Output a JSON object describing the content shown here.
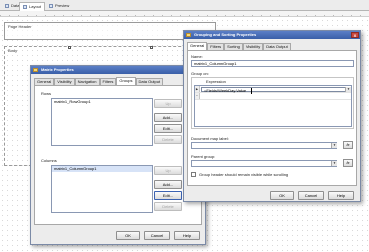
{
  "designer": {
    "tabs": [
      {
        "label": "Data"
      },
      {
        "label": "Layout"
      },
      {
        "label": "Preview"
      }
    ],
    "page_header_label": "Page Header",
    "body_label": "Body"
  },
  "matrix_dialog": {
    "title": "Matrix Properties",
    "tabs": [
      "General",
      "Visibility",
      "Navigation",
      "Filters",
      "Groups",
      "Data Output"
    ],
    "active_tab": "Groups",
    "rows_label": "Rows",
    "rows_items": [
      "matrix1_RowGroup1"
    ],
    "rows_buttons": [
      "Up",
      "Add...",
      "Edit...",
      "Delete"
    ],
    "columns_label": "Columns",
    "columns_items": [
      "matrix1_ColumnGroup1"
    ],
    "columns_buttons": [
      "Up",
      "Add...",
      "Edit...",
      "Delete"
    ],
    "footer_buttons": {
      "ok": "OK",
      "cancel": "Cancel",
      "help": "Help"
    }
  },
  "grouping_dialog": {
    "title": "Grouping and Sorting Properties",
    "close_glyph": "X",
    "tabs": [
      "General",
      "Filters",
      "Sorting",
      "Visibility",
      "Data Output"
    ],
    "active_tab": "General",
    "name_label": "Name:",
    "name_value": "matrix1_ColumnGroup1",
    "group_on_label": "Group on:",
    "expression_header": "Expression",
    "expressions": [
      "=Fields!WeekDay.Value",
      ""
    ],
    "doc_map_label": "Document map label:",
    "doc_map_value": "",
    "parent_group_label": "Parent group:",
    "parent_group_value": "",
    "fx_label": "fx",
    "checkbox_label": "Group header should remain visible while scrolling",
    "checkbox_checked": false,
    "footer_buttons": {
      "ok": "OK",
      "cancel": "Cancel",
      "help": "Help"
    }
  }
}
